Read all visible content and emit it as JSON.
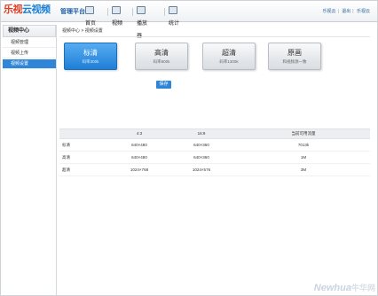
{
  "header": {
    "logo_part1": "乐视",
    "logo_part2": "云视频",
    "platform": "管理平台",
    "nav": [
      {
        "label": "首页",
        "icon": "home-icon"
      },
      {
        "label": "视频",
        "icon": "video-icon"
      },
      {
        "label": "播放器",
        "icon": "player-icon"
      },
      {
        "label": "统计",
        "icon": "stats-icon"
      }
    ],
    "links": [
      "乐视云",
      "退出",
      "乐视云"
    ]
  },
  "sidebar": {
    "title": "视频中心",
    "items": [
      {
        "label": "视频管理"
      },
      {
        "label": "视频上传"
      },
      {
        "label": "视频设置"
      }
    ]
  },
  "main": {
    "breadcrumb": "视频中心 > 视频设置",
    "quality_cards": [
      {
        "name": "标清",
        "desc": "码率300k",
        "active": true
      },
      {
        "name": "高清",
        "desc": "码率800k",
        "active": false
      },
      {
        "name": "超清",
        "desc": "码率1300k",
        "active": false
      },
      {
        "name": "原画",
        "desc": "和视频源一致",
        "active": false
      }
    ],
    "save_label": "保存",
    "table": {
      "headers": [
        "",
        "4:3",
        "16:9",
        "当前可用流量"
      ],
      "rows": [
        [
          "标清",
          "640×480",
          "640×360",
          "7013k"
        ],
        [
          "高清",
          "640×480",
          "640×360",
          "1M"
        ],
        [
          "超清",
          "1024×768",
          "1024×576",
          "3M"
        ]
      ]
    }
  },
  "watermark": {
    "text": "Newhua",
    "cn": "牛华网"
  },
  "colors": {
    "accent": "#2f86d8",
    "logo_red": "#e03a1e",
    "logo_blue": "#1a7fd4"
  }
}
